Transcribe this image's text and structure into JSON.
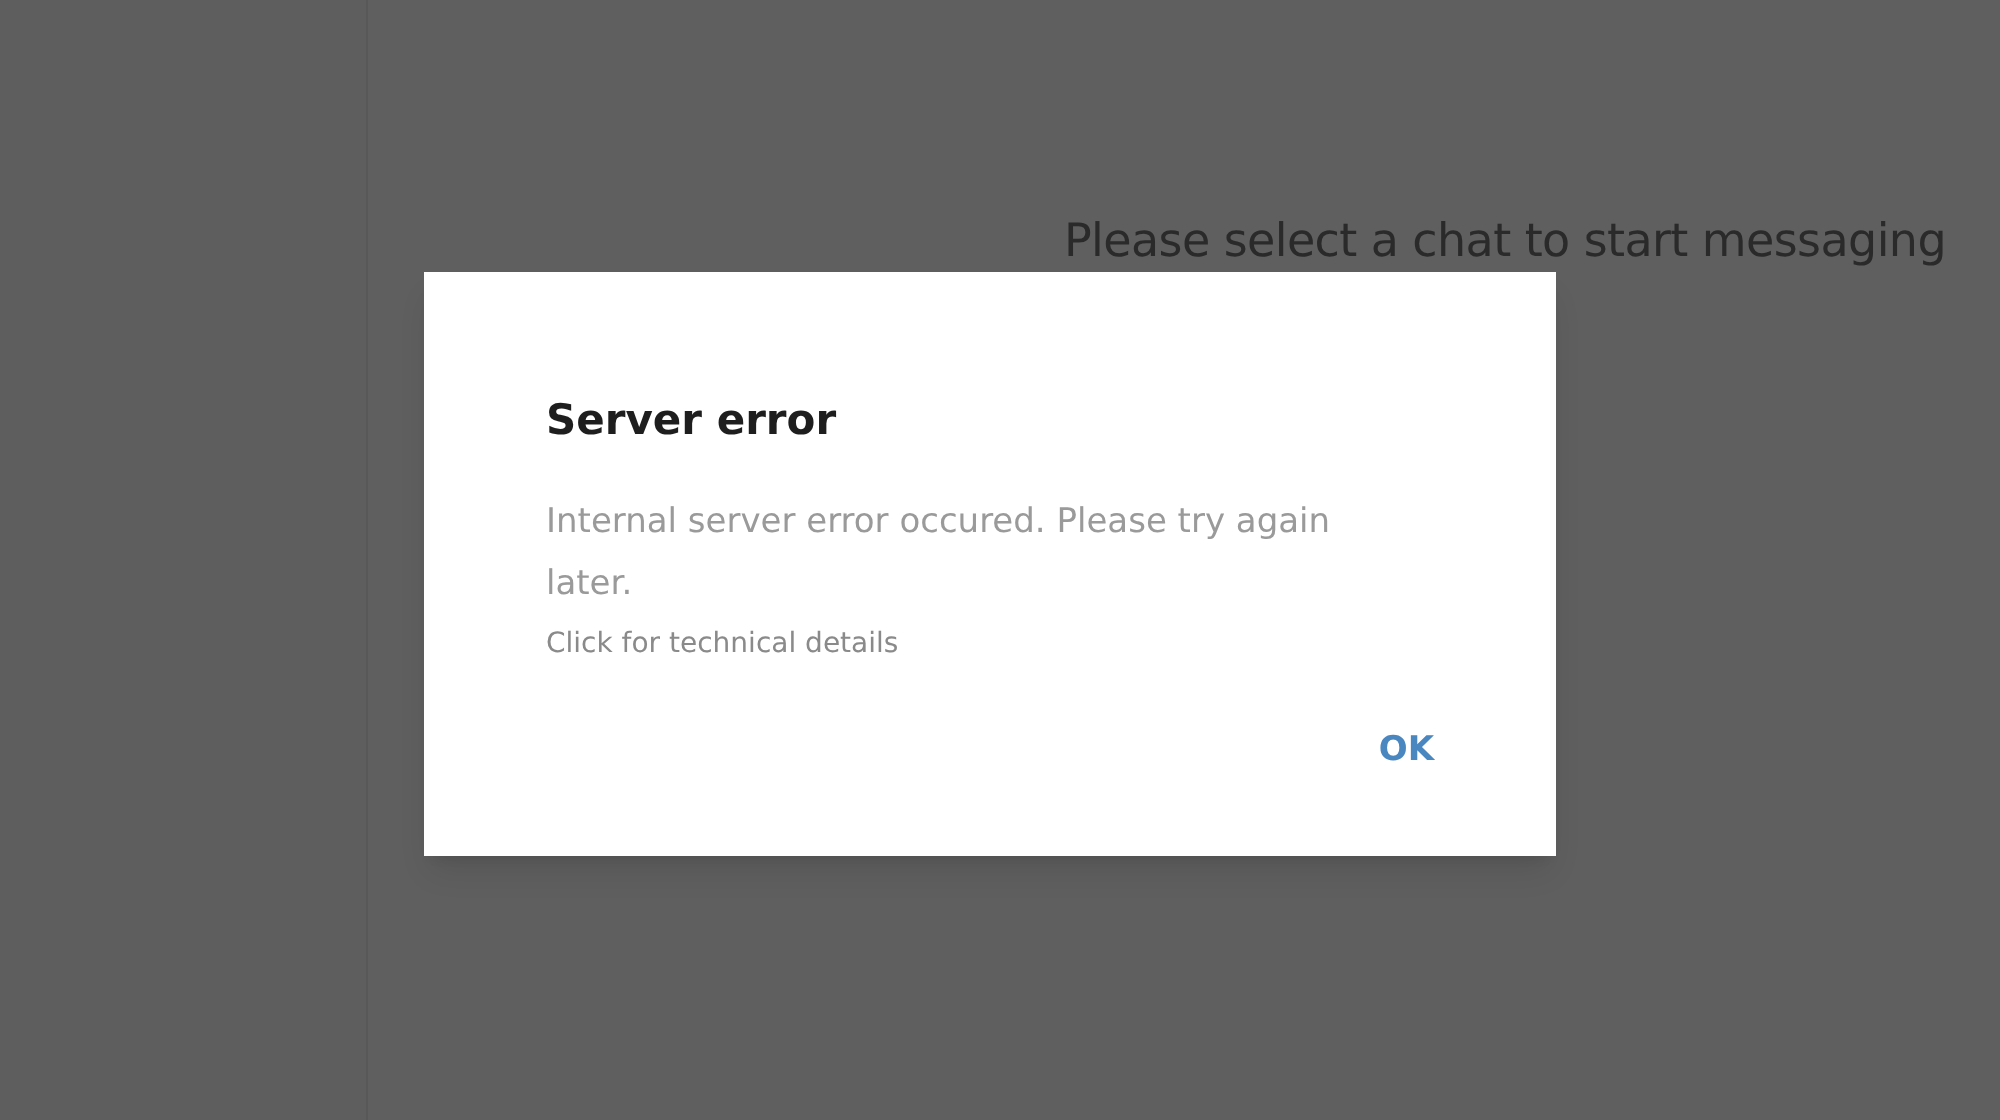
{
  "main": {
    "placeholder_text": "Please select a chat to start messaging"
  },
  "dialog": {
    "title": "Server error",
    "message": "Internal server error occured. Please try again later.",
    "details_link": "Click for technical details",
    "buttons": [
      "OK"
    ]
  }
}
